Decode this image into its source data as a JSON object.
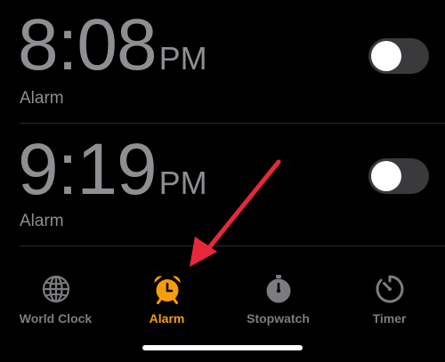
{
  "alarms": [
    {
      "time": "8:08",
      "period": "PM",
      "label": "Alarm",
      "enabled": false
    },
    {
      "time": "9:19",
      "period": "PM",
      "label": "Alarm",
      "enabled": false
    }
  ],
  "tabs": [
    {
      "label": "World Clock",
      "icon": "globe-icon",
      "active": false
    },
    {
      "label": "Alarm",
      "icon": "alarm-clock-icon",
      "active": true
    },
    {
      "label": "Stopwatch",
      "icon": "stopwatch-icon",
      "active": false
    },
    {
      "label": "Timer",
      "icon": "timer-icon",
      "active": false
    }
  ],
  "colors": {
    "background": "#000000",
    "text_inactive": "#8e8e93",
    "accent": "#f59e0b",
    "annotation_arrow": "#e8283a",
    "toggle_off": "#3a3a3c"
  }
}
